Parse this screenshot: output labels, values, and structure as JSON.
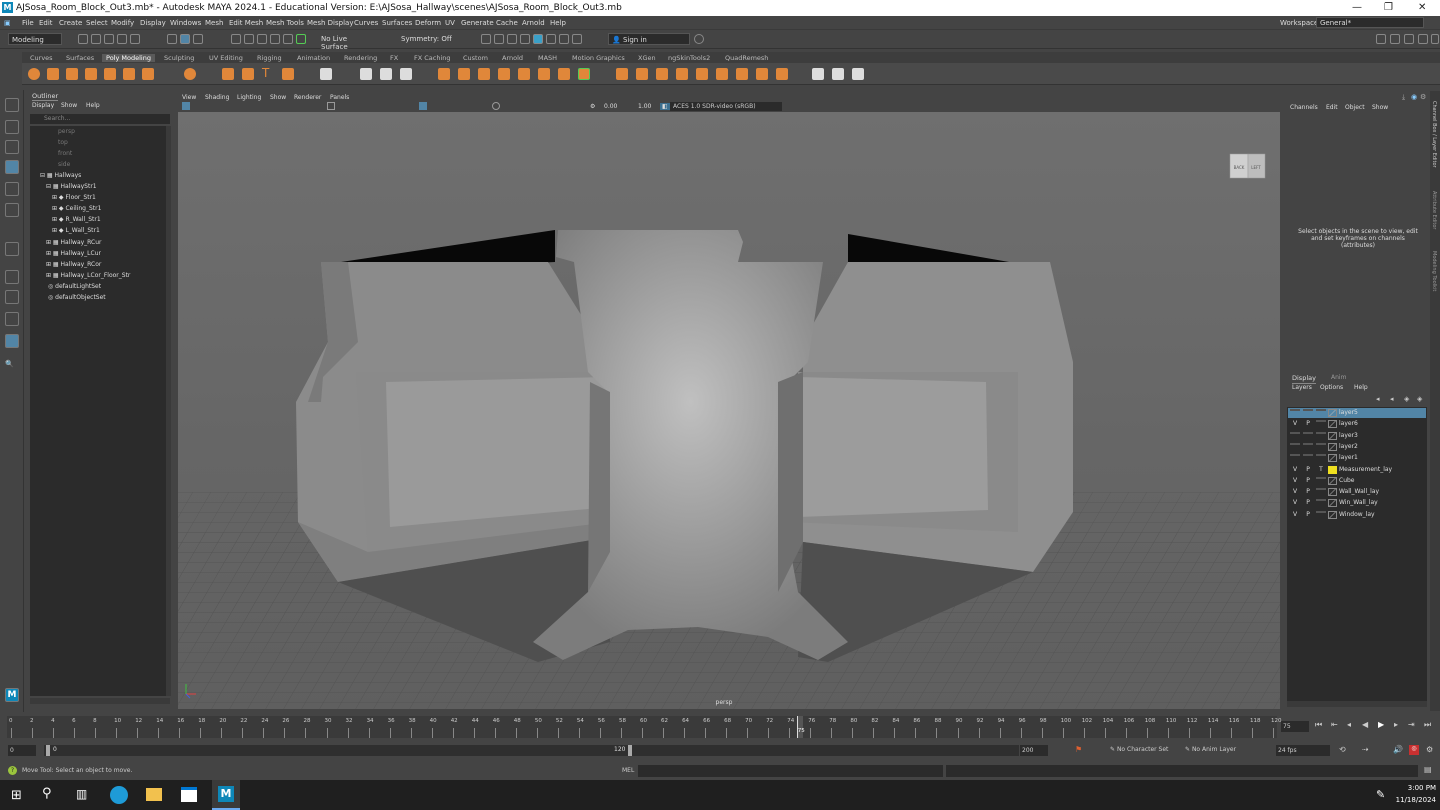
{
  "window": {
    "title": "AJSosa_Room_Block_Out3.mb* - Autodesk MAYA 2024.1 - Educational Version: E:\\AJSosa_Hallway\\scenes\\AJSosa_Room_Block_Out3.mb"
  },
  "menu": [
    "File",
    "Edit",
    "Create",
    "Select",
    "Modify",
    "Display",
    "Windows",
    "Mesh",
    "Edit Mesh",
    "Mesh Tools",
    "Mesh Display",
    "Curves",
    "Surfaces",
    "Deform",
    "UV",
    "Generate",
    "Cache",
    "Arnold",
    "Help"
  ],
  "workspace": {
    "label": "Workspace:",
    "value": "General*"
  },
  "statusline": {
    "mode": "Modeling",
    "live_surface": "No Live Surface",
    "symmetry": "Symmetry: Off",
    "signin": "Sign in"
  },
  "shelf_tabs": [
    "Curves",
    "Surfaces",
    "Poly Modeling",
    "Sculpting",
    "UV Editing",
    "Rigging",
    "Animation",
    "Rendering",
    "FX",
    "FX Caching",
    "Custom",
    "Arnold",
    "MASH",
    "Motion Graphics",
    "XGen",
    "ngSkinTools2",
    "QuadRemesh"
  ],
  "shelf_active": "Poly Modeling",
  "outliner": {
    "title": "Outliner",
    "menu": [
      "Display",
      "Show",
      "Help"
    ],
    "search_placeholder": "Search...",
    "items": [
      {
        "label": "persp",
        "dim": true
      },
      {
        "label": "top",
        "dim": true
      },
      {
        "label": "front",
        "dim": true
      },
      {
        "label": "side",
        "dim": true
      },
      {
        "label": "Hallways"
      },
      {
        "label": "HallwayStr1"
      },
      {
        "label": "Floor_Str1"
      },
      {
        "label": "Ceiling_Str1"
      },
      {
        "label": "R_Wall_Str1"
      },
      {
        "label": "L_Wall_Str1"
      },
      {
        "label": "Hallway_RCur"
      },
      {
        "label": "Hallway_LCur"
      },
      {
        "label": "Hallway_RCor"
      },
      {
        "label": "Hallway_LCor_Floor_Str"
      },
      {
        "label": "defaultLightSet"
      },
      {
        "label": "defaultObjectSet"
      }
    ]
  },
  "viewport": {
    "menu": [
      "View",
      "Shading",
      "Lighting",
      "Show",
      "Renderer",
      "Panels"
    ],
    "exposure": "0.00",
    "gamma": "1.00",
    "colorspace": "ACES 1.0 SDR-video (sRGB)",
    "camera": "persp",
    "cube_back": "BACK",
    "cube_left": "LEFT"
  },
  "channelbox": {
    "menu": [
      "Channels",
      "Edit",
      "Object",
      "Show"
    ],
    "message": "Select objects in the scene to view, edit and set keyframes on channels (attributes)",
    "side_tabs": [
      "Channel Box / Layer Editor",
      "Attribute Editor",
      "Modeling Toolkit"
    ]
  },
  "layer_editor": {
    "tabs": [
      "Display",
      "Anim"
    ],
    "menu": [
      "Layers",
      "Options",
      "Help"
    ],
    "layers": [
      {
        "v": "",
        "p": "",
        "t": "",
        "name": "layer5",
        "selected": true,
        "color": ""
      },
      {
        "v": "V",
        "p": "P",
        "t": "",
        "name": "layer6",
        "color": ""
      },
      {
        "v": "",
        "p": "",
        "t": "",
        "name": "layer3",
        "color": ""
      },
      {
        "v": "",
        "p": "",
        "t": "",
        "name": "layer2",
        "color": ""
      },
      {
        "v": "",
        "p": "",
        "t": "",
        "name": "layer1",
        "color": ""
      },
      {
        "v": "V",
        "p": "P",
        "t": "T",
        "name": "Measurement_lay",
        "color": "#f0e020"
      },
      {
        "v": "V",
        "p": "P",
        "t": "",
        "name": "Cube",
        "color": ""
      },
      {
        "v": "V",
        "p": "P",
        "t": "",
        "name": "Wall_Wall_lay",
        "color": ""
      },
      {
        "v": "V",
        "p": "P",
        "t": "",
        "name": "Win_Wall_lay",
        "color": ""
      },
      {
        "v": "V",
        "p": "P",
        "t": "",
        "name": "Window_lay",
        "color": ""
      }
    ]
  },
  "timeline": {
    "ticks": [
      "0",
      "2",
      "4",
      "6",
      "8",
      "10",
      "12",
      "14",
      "16",
      "18",
      "20",
      "22",
      "24",
      "26",
      "28",
      "30",
      "32",
      "34",
      "36",
      "38",
      "40",
      "42",
      "44",
      "46",
      "48",
      "50",
      "52",
      "54",
      "56",
      "58",
      "60",
      "62",
      "64",
      "66",
      "68",
      "70",
      "72",
      "74",
      "76",
      "78",
      "80",
      "82",
      "84",
      "86",
      "88",
      "90",
      "92",
      "94",
      "96",
      "98",
      "100",
      "102",
      "104",
      "106",
      "108",
      "110",
      "112",
      "114",
      "116",
      "118",
      "120"
    ],
    "current": "75",
    "current_field": "75"
  },
  "range": {
    "start": "0",
    "inner_start": "0",
    "inner_end": "120",
    "end": "200",
    "character_set": "No Character Set",
    "anim_layer": "No Anim Layer",
    "fps": "24 fps"
  },
  "commandline": {
    "help": "Move Tool: Select an object to move.",
    "mel": "MEL"
  },
  "taskbar": {
    "time": "3:00 PM",
    "date": "11/18/2024"
  }
}
